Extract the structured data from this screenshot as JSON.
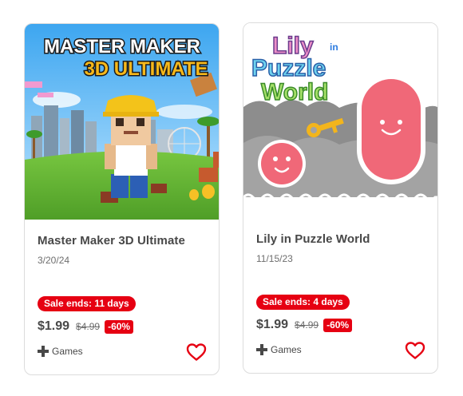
{
  "cards": [
    {
      "title": "Master Maker 3D Ultimate",
      "art_text_line1": "MASTER MAKER",
      "art_text_line2": "3D ULTIMATE",
      "date": "3/20/24",
      "sale_label": "Sale ends: 11 days",
      "price": "$1.99",
      "original_price": "$4.99",
      "discount": "-60%",
      "platform": "Games",
      "platform_icon": "dpad-icon",
      "wishlist_icon": "heart-outline-icon"
    },
    {
      "title": "Lily in Puzzle World",
      "art_text_line1": "Lily",
      "art_text_line1b": "in",
      "art_text_line2": "Puzzle",
      "art_text_line3": "World",
      "date": "11/15/23",
      "sale_label": "Sale ends: 4 days",
      "price": "$1.99",
      "original_price": "$4.99",
      "discount": "-60%",
      "platform": "Games",
      "platform_icon": "dpad-icon",
      "wishlist_icon": "heart-outline-icon"
    }
  ],
  "colors": {
    "sale_red": "#e60012",
    "heart_red": "#e60012",
    "text_dark": "#484848",
    "text_muted": "#6e6e6e"
  }
}
